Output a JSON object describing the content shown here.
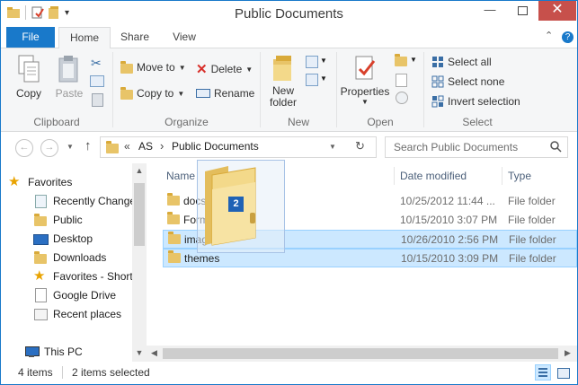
{
  "window": {
    "title": "Public Documents"
  },
  "tabs": {
    "file": "File",
    "home": "Home",
    "share": "Share",
    "view": "View"
  },
  "ribbon": {
    "clipboard": {
      "label": "Clipboard",
      "copy": "Copy",
      "paste": "Paste"
    },
    "organize": {
      "label": "Organize",
      "move_to": "Move to",
      "copy_to": "Copy to",
      "delete": "Delete",
      "rename": "Rename"
    },
    "new": {
      "label": "New",
      "new_folder_line1": "New",
      "new_folder_line2": "folder"
    },
    "open": {
      "label": "Open",
      "properties": "Properties"
    },
    "select": {
      "label": "Select",
      "select_all": "Select all",
      "select_none": "Select none",
      "invert": "Invert selection"
    }
  },
  "address": {
    "overflow": "«",
    "part1": "AS",
    "sep": "›",
    "part2": "Public Documents"
  },
  "search": {
    "placeholder": "Search Public Documents"
  },
  "nav": {
    "items": [
      {
        "label": "Favorites",
        "icon": "star-icon"
      },
      {
        "label": "Recently Changed",
        "icon": "recent-icon"
      },
      {
        "label": "Public",
        "icon": "folder-icon"
      },
      {
        "label": "Desktop",
        "icon": "desktop-icon"
      },
      {
        "label": "Downloads",
        "icon": "downloads-icon"
      },
      {
        "label": "Favorites - Shortcuts",
        "icon": "star-icon"
      },
      {
        "label": "Google Drive",
        "icon": "document-icon"
      },
      {
        "label": "Recent places",
        "icon": "recent-places-icon"
      },
      {
        "label": "This PC",
        "icon": "computer-icon"
      }
    ]
  },
  "columns": {
    "name": "Name",
    "date": "Date modified",
    "type": "Type"
  },
  "files": [
    {
      "name": "docs",
      "date": "10/25/2012 11:44 ...",
      "type": "File folder"
    },
    {
      "name": "Forms",
      "date": "10/15/2010 3:07 PM",
      "type": "File folder"
    },
    {
      "name": "images",
      "date": "10/26/2010 2:56 PM",
      "type": "File folder"
    },
    {
      "name": "themes",
      "date": "10/15/2010 3:09 PM",
      "type": "File folder"
    }
  ],
  "drag": {
    "count": "2"
  },
  "status": {
    "items": "4 items",
    "selected": "2 items selected"
  },
  "colors": {
    "accent": "#1979ca",
    "selection": "#cce8ff",
    "close": "#c7504b"
  }
}
